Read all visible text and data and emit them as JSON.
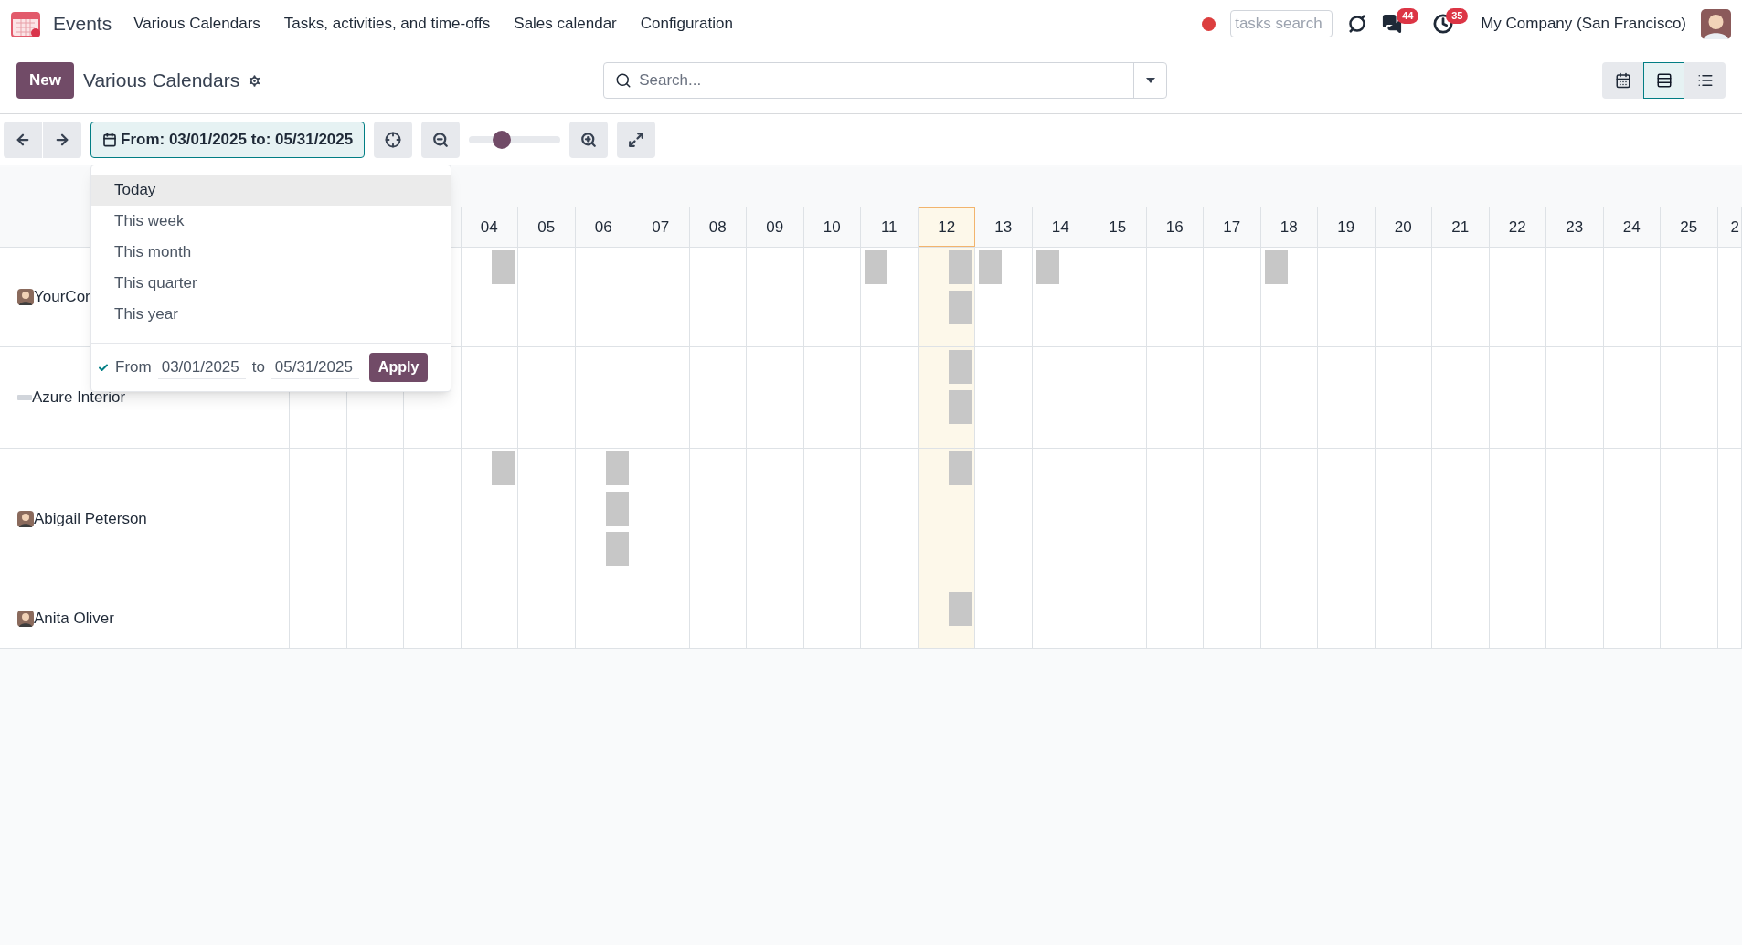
{
  "app": {
    "name": "Events"
  },
  "menu": [
    "Various Calendars",
    "Tasks, activities, and time-offs",
    "Sales calendar",
    "Configuration"
  ],
  "systray": {
    "search_placeholder": "tasks search",
    "messages_badge": "44",
    "activities_badge": "35",
    "company": "My Company (San Francisco)"
  },
  "control_panel": {
    "new_button": "New",
    "title": "Various Calendars",
    "search_placeholder": "Search...",
    "views": [
      {
        "kind": "calendar",
        "selected": false
      },
      {
        "kind": "gantt",
        "selected": true
      },
      {
        "kind": "list",
        "selected": false
      }
    ]
  },
  "toolbar": {
    "range_button": "From: 03/01/2025 to: 05/31/2025",
    "zoom": {
      "level": 0.36
    }
  },
  "range_menu": {
    "items": [
      {
        "label": "Today",
        "highlighted": true
      },
      {
        "label": "This week",
        "highlighted": false
      },
      {
        "label": "This month",
        "highlighted": false
      },
      {
        "label": "This quarter",
        "highlighted": false
      },
      {
        "label": "This year",
        "highlighted": false
      }
    ],
    "custom": {
      "checked": true,
      "from_label": "From",
      "from_value": "03/01/2025",
      "to_label": "to",
      "to_value": "05/31/2025",
      "apply": "Apply"
    }
  },
  "days": [
    {
      "label": "04",
      "today": false
    },
    {
      "label": "05",
      "today": false
    },
    {
      "label": "06",
      "today": false
    },
    {
      "label": "07",
      "today": false
    },
    {
      "label": "08",
      "today": false
    },
    {
      "label": "09",
      "today": false
    },
    {
      "label": "10",
      "today": false
    },
    {
      "label": "11",
      "today": false
    },
    {
      "label": "12",
      "today": true
    },
    {
      "label": "13",
      "today": false
    },
    {
      "label": "14",
      "today": false
    },
    {
      "label": "15",
      "today": false
    },
    {
      "label": "16",
      "today": false
    },
    {
      "label": "17",
      "today": false
    },
    {
      "label": "18",
      "today": false
    },
    {
      "label": "19",
      "today": false
    },
    {
      "label": "20",
      "today": false
    },
    {
      "label": "21",
      "today": false
    },
    {
      "label": "22",
      "today": false
    },
    {
      "label": "23",
      "today": false
    },
    {
      "label": "24",
      "today": false
    },
    {
      "label": "25",
      "today": false
    },
    {
      "label": "2",
      "today": false
    }
  ],
  "rows": [
    {
      "name": "YourCor",
      "has_logo": false,
      "cells": [
        [
          {
            "late": true
          }
        ],
        [],
        [],
        [],
        [],
        [],
        [],
        [
          {
            "late": false
          }
        ],
        [
          {
            "late": true
          },
          {
            "late": true
          }
        ],
        [
          {
            "late": false
          }
        ],
        [
          {
            "late": false
          }
        ],
        [],
        [],
        [],
        [
          {
            "late": false
          }
        ],
        [],
        [],
        [],
        [],
        [],
        [],
        [],
        []
      ]
    },
    {
      "name": "Azure Interior",
      "has_logo": true,
      "cells": [
        [],
        [],
        [],
        [],
        [],
        [],
        [],
        [],
        [
          {
            "late": true
          },
          {
            "late": true
          }
        ],
        [],
        [],
        [],
        [],
        [],
        [],
        [],
        [],
        [],
        [],
        [],
        [],
        [],
        []
      ]
    },
    {
      "name": "Abigail Peterson",
      "has_logo": false,
      "cells": [
        [
          {
            "late": true
          }
        ],
        [],
        [
          {
            "late": true
          },
          {
            "late": true
          },
          {
            "late": true
          }
        ],
        [],
        [],
        [],
        [],
        [],
        [
          {
            "late": true
          }
        ],
        [],
        [],
        [],
        [],
        [],
        [],
        [],
        [],
        [],
        [],
        [],
        [],
        [],
        []
      ]
    },
    {
      "name": "Anita Oliver",
      "has_logo": false,
      "cells": [
        [],
        [],
        [],
        [],
        [],
        [],
        [],
        [],
        [
          {
            "late": true
          }
        ],
        [],
        [],
        [],
        [],
        [],
        [],
        [],
        [],
        [],
        [],
        [],
        [],
        [],
        []
      ]
    }
  ]
}
